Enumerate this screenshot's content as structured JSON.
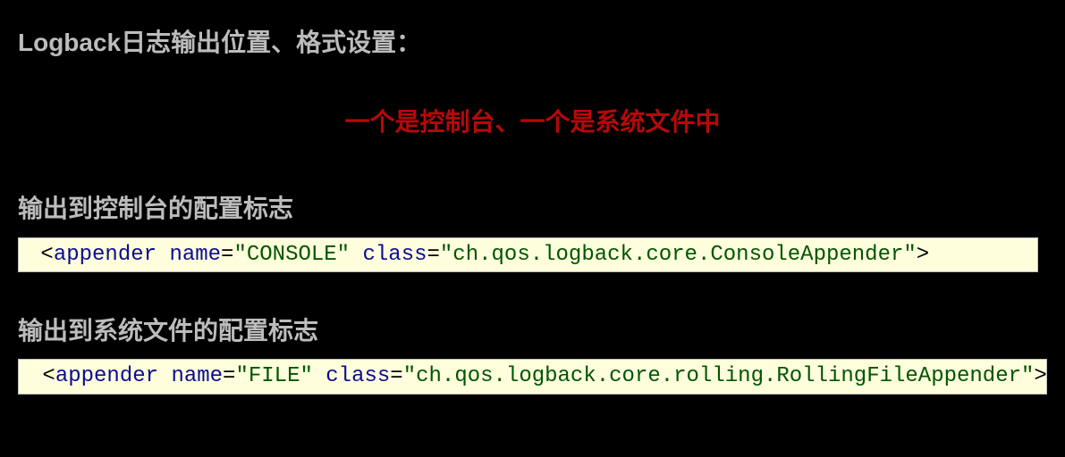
{
  "heading": "Logback日志输出位置、格式设置：",
  "red_note": "一个是控制台、一个是系统文件中",
  "sub1": "输出到控制台的配置标志",
  "sub2": "输出到系统文件的配置标志",
  "code1": {
    "leadspace": " ",
    "lt": "<",
    "tag": "appender",
    "sp1": " ",
    "attr1": "name",
    "eq1": "=",
    "val1": "\"CONSOLE\"",
    "sp2": " ",
    "attr2": "class",
    "eq2": "=",
    "val2": "\"ch.qos.logback.core.ConsoleAppender\"",
    "gt": ">"
  },
  "code2": {
    "leadspace": " ",
    "lt": "<",
    "tag": "appender",
    "sp1": " ",
    "attr1": "name",
    "eq1": "=",
    "val1": "\"FILE\"",
    "sp2": " ",
    "attr2": "class",
    "eq2": "=",
    "val2": "\"ch.qos.logback.core.rolling.RollingFileAppender\"",
    "gt": ">"
  }
}
